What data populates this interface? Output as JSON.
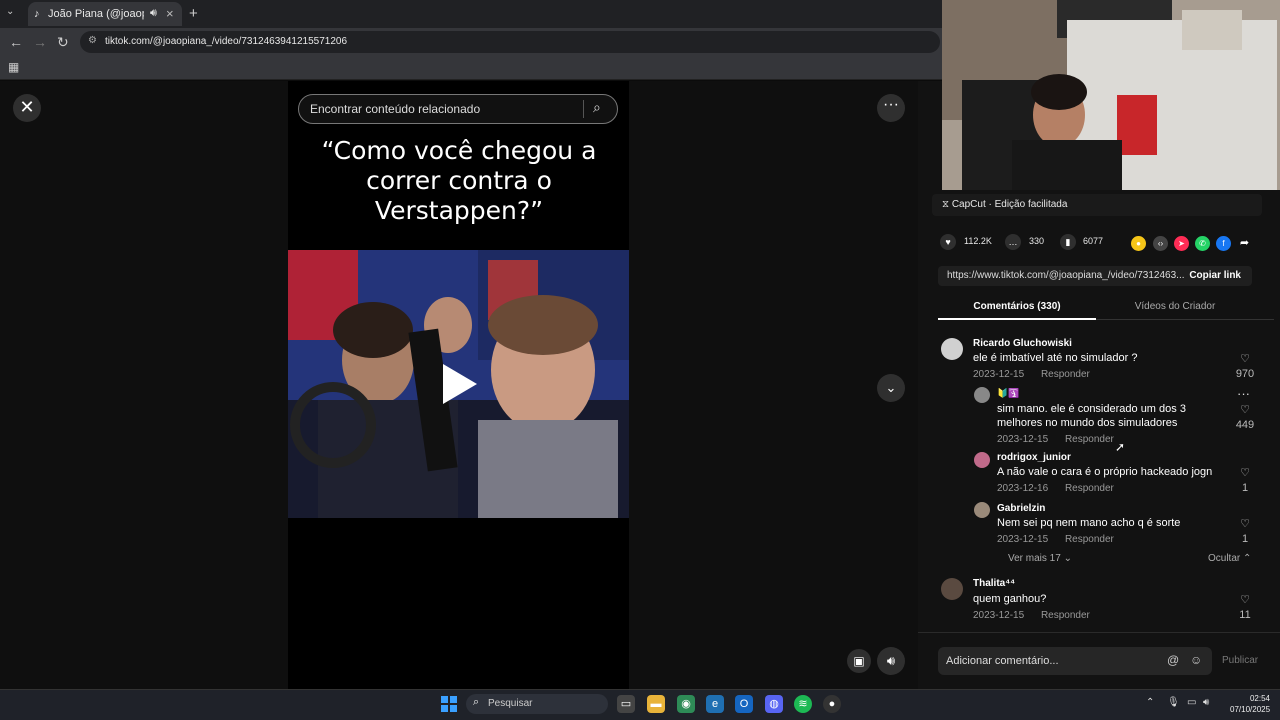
{
  "browser": {
    "tab_title": "João Piana (@joaopiana_) |",
    "url": "tiktok.com/@joaopiana_/video/7312463941215571206"
  },
  "video": {
    "search_placeholder": "Encontrar conteúdo relacionado",
    "caption_quote": "“Como você chegou a correr contra o Verstappen?”"
  },
  "panel": {
    "capcut_label": "CapCut · Edição facilitada",
    "likes": "112.2K",
    "comments": "330",
    "saves": "6077",
    "share_link": "https://www.tiktok.com/@joaopiana_/video/7312463...",
    "copy_link": "Copiar link",
    "tab_comments": "Comentários (330)",
    "tab_creator": "Vídeos do Criador"
  },
  "comments": [
    {
      "user": "Ricardo Gluchowiski",
      "text": "ele é imbatível até no simulador ?",
      "date": "2023-12-15",
      "reply": "Responder",
      "likes": "970"
    },
    {
      "user": "",
      "badges": "🔰🛐",
      "text": "sim mano. ele é considerado um dos 3 melhores no mundo dos simuladores",
      "date": "2023-12-15",
      "reply": "Responder",
      "likes": "449"
    },
    {
      "user": "rodrigox_junior",
      "text": "A não vale o cara é o próprio hackeado jogn",
      "date": "2023-12-16",
      "reply": "Responder",
      "likes": "1"
    },
    {
      "user": "Gabrielzin",
      "text": "Nem sei pq nem mano acho q é sorte",
      "date": "2023-12-15",
      "reply": "Responder",
      "likes": "1"
    },
    {
      "user": "Thalita⁴⁴",
      "text": "quem ganhou?",
      "date": "2023-12-15",
      "reply": "Responder",
      "likes": "11"
    }
  ],
  "thread": {
    "more": "Ver mais 17",
    "hide": "Ocultar"
  },
  "composer": {
    "placeholder": "Adicionar comentário...",
    "publish": "Publicar"
  },
  "taskbar": {
    "search": "Pesquisar",
    "time": "02:54",
    "date": "07/10/2025"
  },
  "colors": {
    "accent": "#fe2c55",
    "panel_bg": "#121212",
    "taskbar": "#1f2229"
  }
}
